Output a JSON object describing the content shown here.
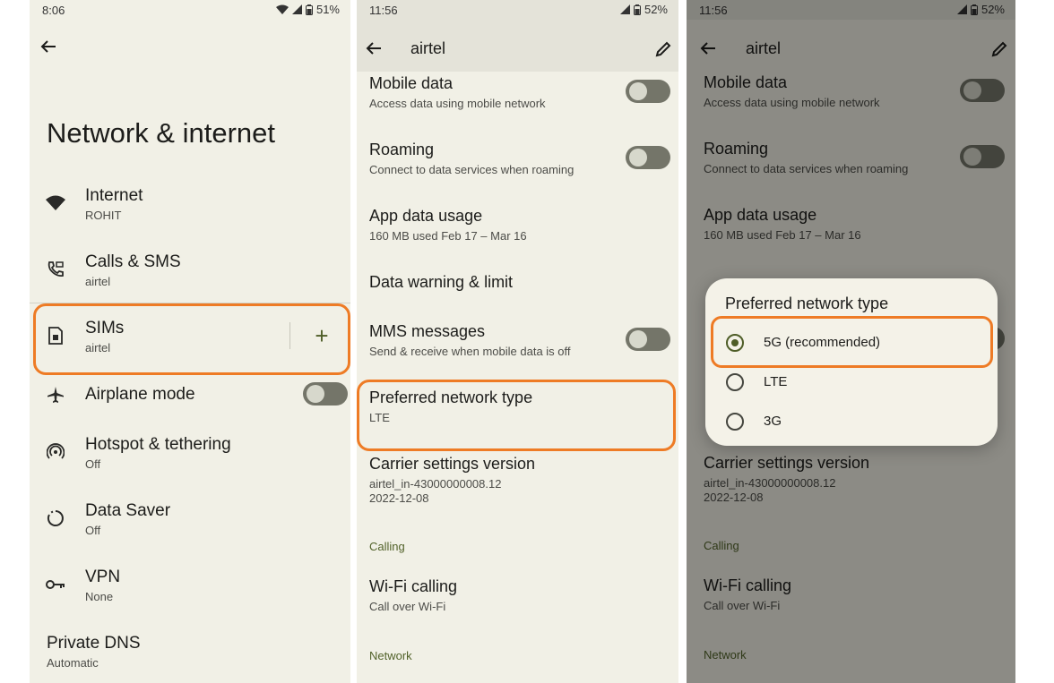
{
  "panel1": {
    "status_time": "8:06",
    "status_battery": "51%",
    "page_title": "Network & internet",
    "items": [
      {
        "label": "Internet",
        "sub": "ROHIT"
      },
      {
        "label": "Calls & SMS",
        "sub": "airtel"
      },
      {
        "label": "SIMs",
        "sub": "airtel"
      },
      {
        "label": "Airplane mode",
        "sub": ""
      },
      {
        "label": "Hotspot & tethering",
        "sub": "Off"
      },
      {
        "label": "Data Saver",
        "sub": "Off"
      },
      {
        "label": "VPN",
        "sub": "None"
      },
      {
        "label": "Private DNS",
        "sub": "Automatic"
      }
    ],
    "add_symbol": "+"
  },
  "panel2": {
    "status_time": "11:56",
    "status_battery": "52%",
    "appbar_title": "airtel",
    "items": [
      {
        "label": "Mobile data",
        "sub": "Access data using mobile network"
      },
      {
        "label": "Roaming",
        "sub": "Connect to data services when roaming"
      },
      {
        "label": "App data usage",
        "sub": "160 MB used Feb 17 – Mar 16"
      },
      {
        "label": "Data warning & limit",
        "sub": ""
      },
      {
        "label": "MMS messages",
        "sub": "Send & receive when mobile data is off"
      },
      {
        "label": "Preferred network type",
        "sub": "LTE"
      },
      {
        "label": "Carrier settings version",
        "sub": "airtel_in-43000000008.12",
        "sub2": "2022-12-08"
      },
      {
        "label": "Wi-Fi calling",
        "sub": "Call over Wi-Fi"
      }
    ],
    "section_calling": "Calling",
    "section_network": "Network"
  },
  "panel3": {
    "status_time": "11:56",
    "status_battery": "52%",
    "appbar_title": "airtel",
    "items": [
      {
        "label": "Mobile data",
        "sub": "Access data using mobile network"
      },
      {
        "label": "Roaming",
        "sub": "Connect to data services when roaming"
      },
      {
        "label": "App data usage",
        "sub": "160 MB used Feb 17 – Mar 16"
      },
      {
        "label": "Carrier settings version",
        "sub": "airtel_in-43000000008.12",
        "sub2": "2022-12-08"
      },
      {
        "label": "Wi-Fi calling",
        "sub": "Call over Wi-Fi"
      }
    ],
    "section_calling": "Calling",
    "section_network": "Network",
    "dialog": {
      "title": "Preferred network type",
      "options": [
        "5G (recommended)",
        "LTE",
        "3G"
      ],
      "selected": "5G (recommended)"
    }
  },
  "colors": {
    "highlight": "#ee7b25",
    "background": "#f1f0e6",
    "accent": "#4e5d27"
  }
}
